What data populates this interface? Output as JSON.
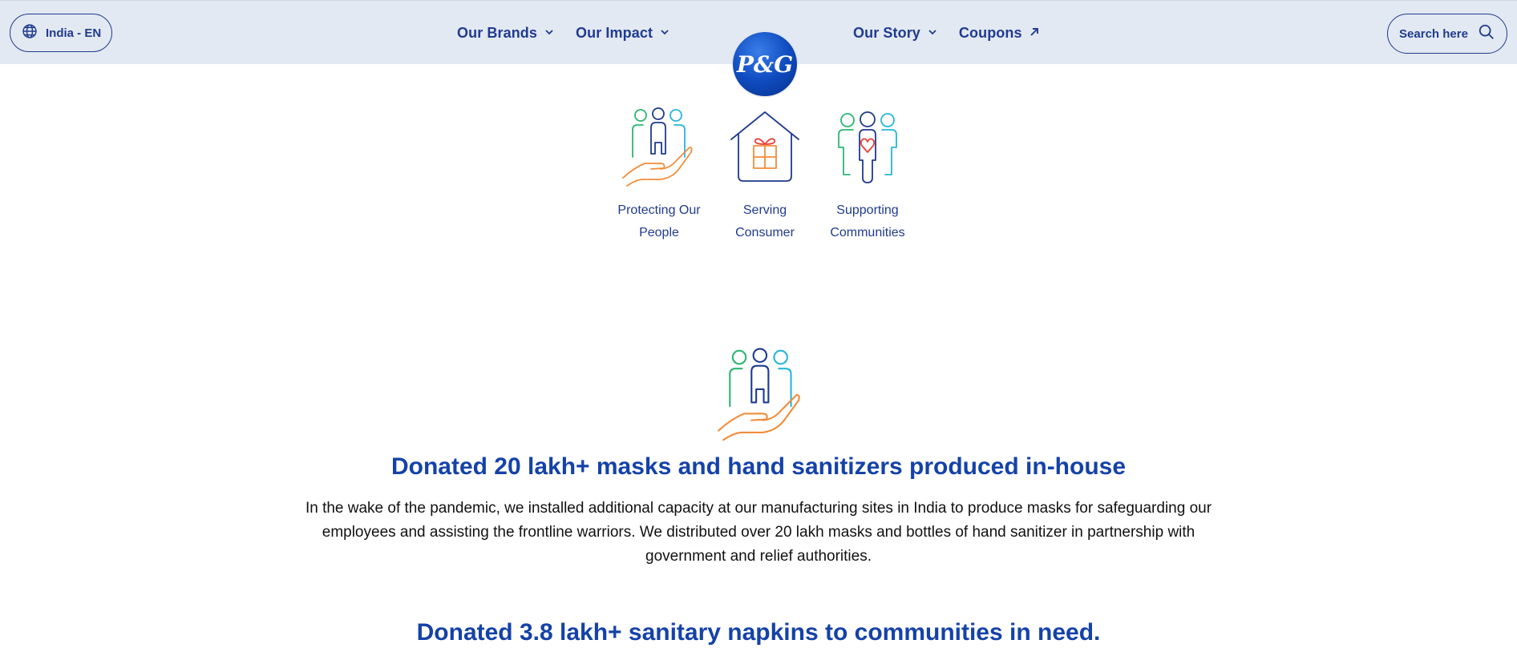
{
  "header": {
    "locale": "India - EN",
    "nav_left": [
      {
        "label": "Our Brands"
      },
      {
        "label": "Our Impact"
      }
    ],
    "nav_right": [
      {
        "label": "Our Story"
      },
      {
        "label": "Coupons"
      }
    ],
    "search_label": "Search here",
    "logo_text": "P&G"
  },
  "tabs": [
    {
      "label_line1": "Protecting Our",
      "label_line2": "People"
    },
    {
      "label_line1": "Serving",
      "label_line2": "Consumer"
    },
    {
      "label_line1": "Supporting",
      "label_line2": "Communities"
    }
  ],
  "section": {
    "heading": "Donated 20 lakh+ masks and hand sanitizers produced in-house",
    "body": "In the wake of the pandemic, we installed additional capacity at our manufacturing sites in India to produce masks for safeguarding our employees and assisting the frontline warriors. We distributed over 20 lakh masks and bottles of hand sanitizer in partnership with government and relief authorities.",
    "next_heading": "Donated 3.8 lakh+ sanitary napkins to communities in need."
  },
  "colors": {
    "brand_blue": "#1f3b8f",
    "heading_blue": "#1542a8",
    "header_bg": "#e3e9f2",
    "green": "#2bb673",
    "teal": "#26b6d9",
    "orange": "#f28c3a",
    "red": "#e8413a"
  }
}
